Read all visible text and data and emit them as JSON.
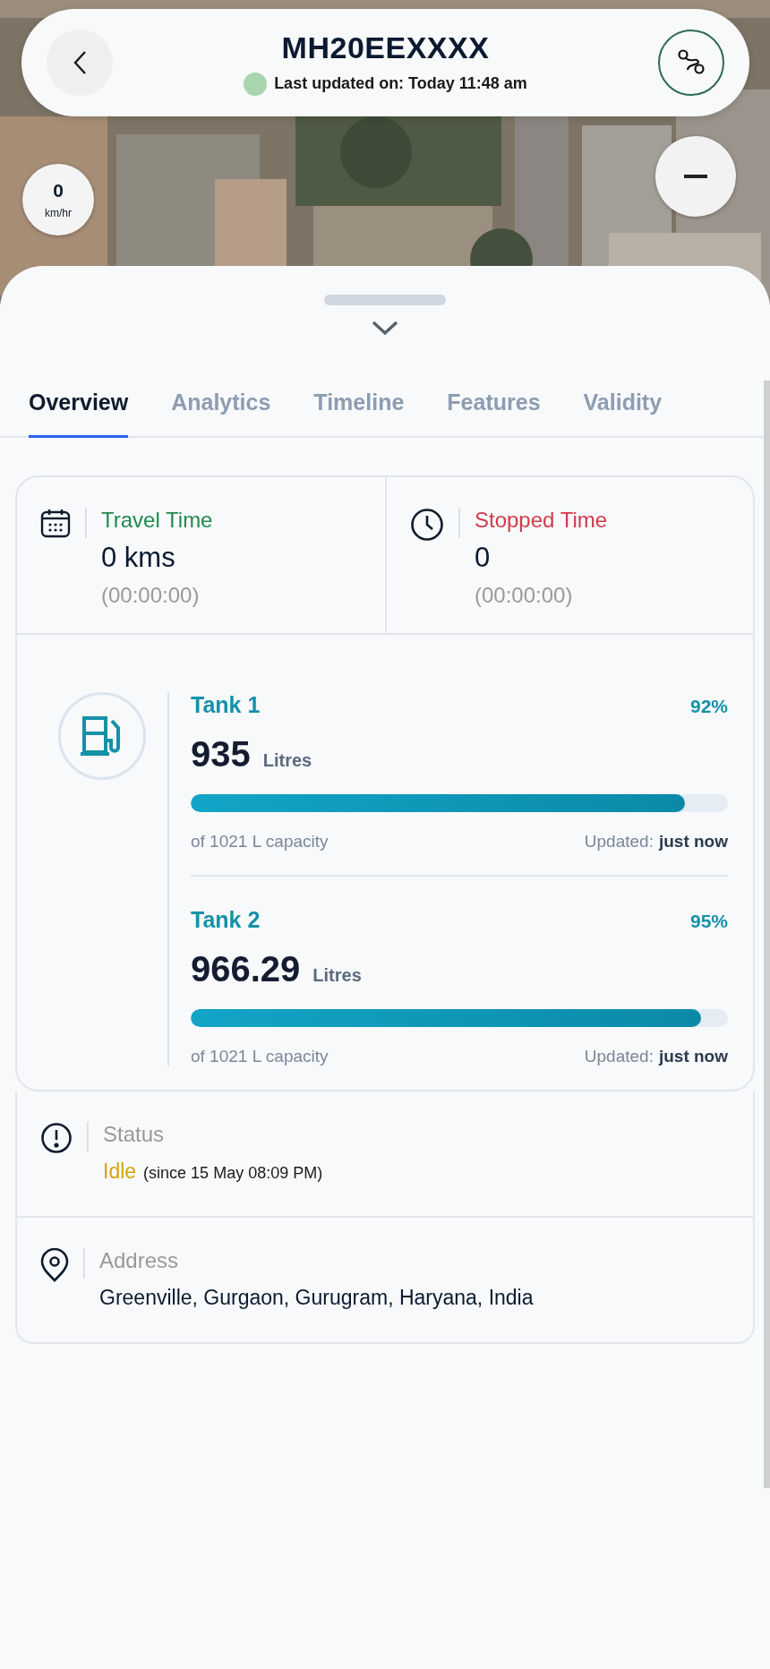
{
  "header": {
    "title": "MH20EEXXXX",
    "online": true,
    "last_updated": "Last updated on: Today 11:48 am"
  },
  "speed": {
    "value": "0",
    "unit": "km/hr"
  },
  "tabs": [
    {
      "label": "Overview",
      "selected": true
    },
    {
      "label": "Analytics",
      "selected": false
    },
    {
      "label": "Timeline",
      "selected": false
    },
    {
      "label": "Features",
      "selected": false
    },
    {
      "label": "Validity",
      "selected": false
    }
  ],
  "stats": [
    {
      "kind": "travel",
      "label": "Travel Time",
      "value": "0 kms",
      "duration": "(00:00:00)"
    },
    {
      "kind": "stopped",
      "label": "Stopped Time",
      "value": "0",
      "duration": "(00:00:00)"
    }
  ],
  "tanks": [
    {
      "name": "Tank 1",
      "percent": "92%",
      "amount": "935",
      "unit": "Litres",
      "level": 0.92,
      "capacity": "of 1021 L capacity",
      "updated_label": "Updated:",
      "updated_value": "just now"
    },
    {
      "name": "Tank 2",
      "percent": "95%",
      "amount": "966.29",
      "unit": "Litres",
      "level": 0.95,
      "capacity": "of 1021 L capacity",
      "updated_label": "Updated:",
      "updated_value": "just now"
    }
  ],
  "status": {
    "label": "Status",
    "value": "Idle",
    "color": "#d4a30c",
    "since": "(since 15 May 08:09 PM)"
  },
  "address": {
    "label": "Address",
    "value": "Greenville, Gurgaon, Gurugram, Haryana, India"
  }
}
